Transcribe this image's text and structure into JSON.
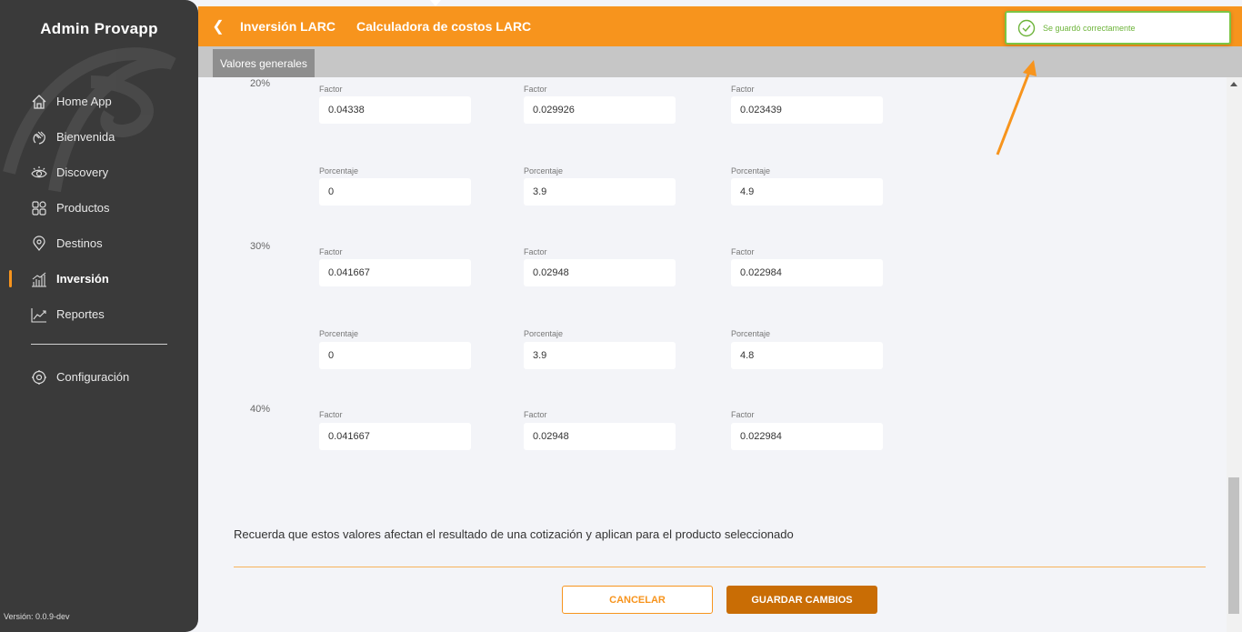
{
  "sidebar": {
    "brand": "Admin Provapp",
    "items": [
      {
        "label": "Home App",
        "icon": "home-icon"
      },
      {
        "label": "Bienvenida",
        "icon": "wave-hand-icon"
      },
      {
        "label": "Discovery",
        "icon": "eye-icon"
      },
      {
        "label": "Productos",
        "icon": "grid-icon"
      },
      {
        "label": "Destinos",
        "icon": "map-pin-icon"
      },
      {
        "label": "Inversión",
        "icon": "bar-chart-icon",
        "active": true
      },
      {
        "label": "Reportes",
        "icon": "trend-chart-icon"
      }
    ],
    "config_label": "Configuración",
    "version": "Versión: 0.0.9-dev"
  },
  "header": {
    "breadcrumb": [
      "Inversión LARC",
      "Calculadora de costos LARC"
    ],
    "subtab": "Valores generales",
    "accent_color": "#f7941d"
  },
  "toast": {
    "message": "Se guardó correctamente",
    "color": "#7cc544"
  },
  "form": {
    "groups": [
      {
        "percent": "20%",
        "factor_label": "Factor",
        "porcentaje_label": "Porcentaje",
        "factors": [
          "0.04338",
          "0.029926",
          "0.023439"
        ],
        "porcentajes": [
          "0",
          "3.9",
          "4.9"
        ]
      },
      {
        "percent": "30%",
        "factor_label": "Factor",
        "porcentaje_label": "Porcentaje",
        "factors": [
          "0.041667",
          "0.02948",
          "0.022984"
        ],
        "porcentajes": [
          "0",
          "3.9",
          "4.8"
        ]
      },
      {
        "percent": "40%",
        "factor_label": "Factor",
        "factors": [
          "0.041667",
          "0.02948",
          "0.022984"
        ]
      }
    ],
    "note": "Recuerda que estos valores afectan el resultado de una cotización y aplican para el producto seleccionado",
    "cancel_label": "CANCELAR",
    "save_label": "GUARDAR CAMBIOS"
  }
}
